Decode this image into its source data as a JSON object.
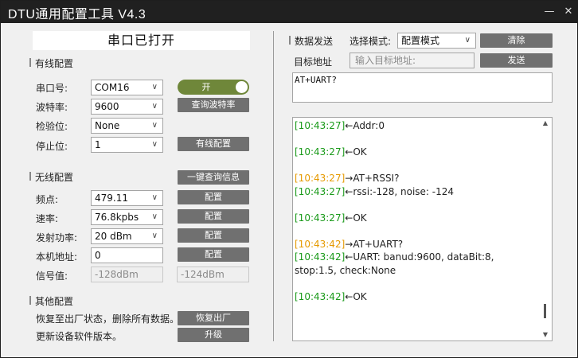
{
  "window": {
    "title": "DTU通用配置工具 V4.3",
    "min_icon": "minimize-icon",
    "close_icon": "close-icon"
  },
  "status": "串口已打开",
  "wired": {
    "title": "有线配置",
    "port_label": "串口号:",
    "port_value": "COM16",
    "toggle_label": "开",
    "baud_label": "波特率:",
    "baud_value": "9600",
    "query_baud": "查询波特率",
    "parity_label": "检验位:",
    "parity_value": "None",
    "stop_label": "停止位:",
    "stop_value": "1",
    "wired_config": "有线配置"
  },
  "wireless": {
    "title": "无线配置",
    "query_all": "一键查询信息",
    "freq_label": "频点:",
    "freq_value": "479.11",
    "rate_label": "速率:",
    "rate_value": "76.8kpbs",
    "power_label": "发射功率:",
    "power_value": "20 dBm",
    "addr_label": "本机地址:",
    "addr_value": "0",
    "config": "配置",
    "signal_label": "信号值:",
    "signal_1": "-128dBm",
    "signal_2": "-124dBm"
  },
  "other": {
    "title": "其他配置",
    "reset_desc": "恢复至出厂状态，删除所有数据。",
    "reset_btn": "恢复出厂",
    "update_desc": "更新设备软件版本。",
    "update_btn": "升级"
  },
  "send": {
    "title": "数据发送",
    "mode_label": "选择模式:",
    "mode_value": "配置模式",
    "clear_btn": "清除",
    "target_label": "目标地址",
    "target_placeholder": "输入目标地址:",
    "send_btn": "发送",
    "content": "AT+UART?"
  },
  "log": [
    {
      "ts": "[10:43:27]",
      "dir": "in",
      "text": "←Addr:0"
    },
    {
      "ts": "",
      "dir": "",
      "text": ""
    },
    {
      "ts": "[10:43:27]",
      "dir": "in",
      "text": "←OK"
    },
    {
      "ts": "",
      "dir": "",
      "text": ""
    },
    {
      "ts": "[10:43:27]",
      "dir": "out",
      "text": "→AT+RSSI?"
    },
    {
      "ts": "[10:43:27]",
      "dir": "in",
      "text": "←rssi:-128, noise: -124"
    },
    {
      "ts": "",
      "dir": "",
      "text": ""
    },
    {
      "ts": "[10:43:27]",
      "dir": "in",
      "text": "←OK"
    },
    {
      "ts": "",
      "dir": "",
      "text": ""
    },
    {
      "ts": "[10:43:42]",
      "dir": "out",
      "text": "→AT+UART?"
    },
    {
      "ts": "[10:43:42]",
      "dir": "in",
      "text": "←UART: banud:9600, dataBit:8, stop:1.5, check:None"
    },
    {
      "ts": "",
      "dir": "",
      "text": ""
    },
    {
      "ts": "[10:43:42]",
      "dir": "in",
      "text": "←OK"
    }
  ]
}
